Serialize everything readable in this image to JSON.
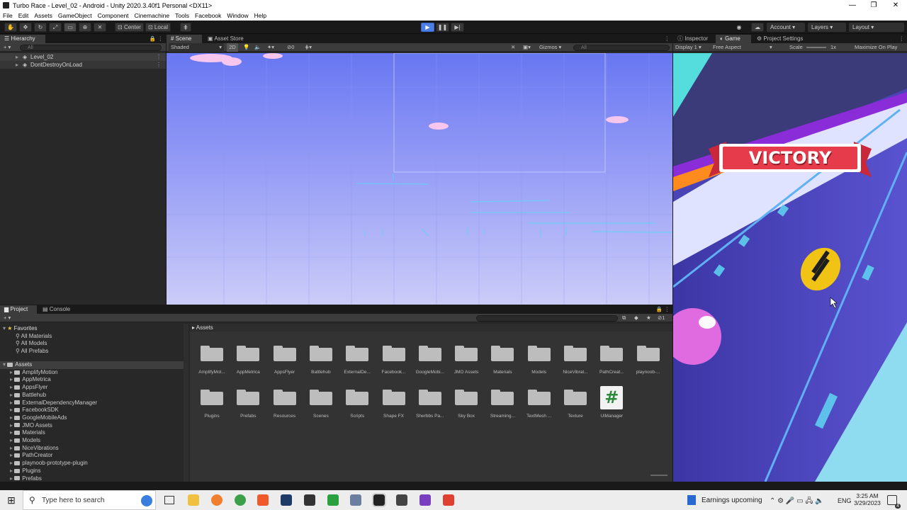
{
  "window": {
    "title": "Turbo Race - Level_02 - Android - Unity 2020.3.40f1 Personal <DX11>"
  },
  "menu": [
    "File",
    "Edit",
    "Assets",
    "GameObject",
    "Component",
    "Cinemachine",
    "Tools",
    "Facebook",
    "Window",
    "Help"
  ],
  "toolbar": {
    "center": "Center",
    "local": "Local",
    "account": "Account",
    "layers": "Layers",
    "layout": "Layout"
  },
  "hierarchy": {
    "tab": "Hierarchy",
    "search": "All",
    "items": [
      "Level_02",
      "DontDestroyOnLoad"
    ]
  },
  "scene": {
    "tabs": [
      "Scene",
      "Asset Store"
    ],
    "shading": "Shaded",
    "mode2d": "2D",
    "gizmos": "Gizmos",
    "search": "All",
    "counter": "0"
  },
  "game": {
    "tabs": [
      "Inspector",
      "Game",
      "Project Settings"
    ],
    "display": "Display 1",
    "aspect": "Free Aspect",
    "scale_label": "Scale",
    "scale_value": "1x",
    "maximize": "Maximize On Play",
    "victory": "VICTORY"
  },
  "project": {
    "tabs": [
      "Project",
      "Console"
    ],
    "favorites_title": "Favorites",
    "favorites": [
      "All Materials",
      "All Models",
      "All Prefabs"
    ],
    "assets_title": "Assets",
    "tree": [
      "AmplifyMotion",
      "AppMetrica",
      "AppsFlyer",
      "Battlehub",
      "ExternalDependencyManager",
      "FacebookSDK",
      "GoogleMobileAds",
      "JMO Assets",
      "Materials",
      "Models",
      "NiceVibrations",
      "PathCreator",
      "playnoob-prototype-plugin",
      "Plugins",
      "Prefabs"
    ],
    "breadcrumb": "Assets",
    "grid_row1": [
      "AmplifyMot...",
      "AppMetrica",
      "AppsFlyer",
      "Battlehub",
      "ExternalDe...",
      "Facebook...",
      "GoogleMobi...",
      "JMO Assets",
      "Materials",
      "Models",
      "NiceVibrat...",
      "PathCreat...",
      "playnoob-..."
    ],
    "grid_row2": [
      "Plugins",
      "Prefabs",
      "Resources",
      "Scenes",
      "Scripts",
      "Shape FX",
      "Sherbbs Pa...",
      "Sky Box",
      "Streaming...",
      "TextMesh ...",
      "Texture",
      "UiManager"
    ],
    "script_symbol": "#",
    "hidden_count": "1"
  },
  "taskbar": {
    "search_placeholder": "Type here to search",
    "news": "Earnings upcoming",
    "lang": "ENG",
    "time": "3:25 AM",
    "date": "3/29/2023",
    "notif": "4"
  },
  "colors": {
    "accent": "#4c7fe3",
    "sky_top": "#5a6cf0",
    "sky_bottom": "#c6c8f8",
    "victory": "#e63b4a",
    "track": "#4b44b8"
  }
}
